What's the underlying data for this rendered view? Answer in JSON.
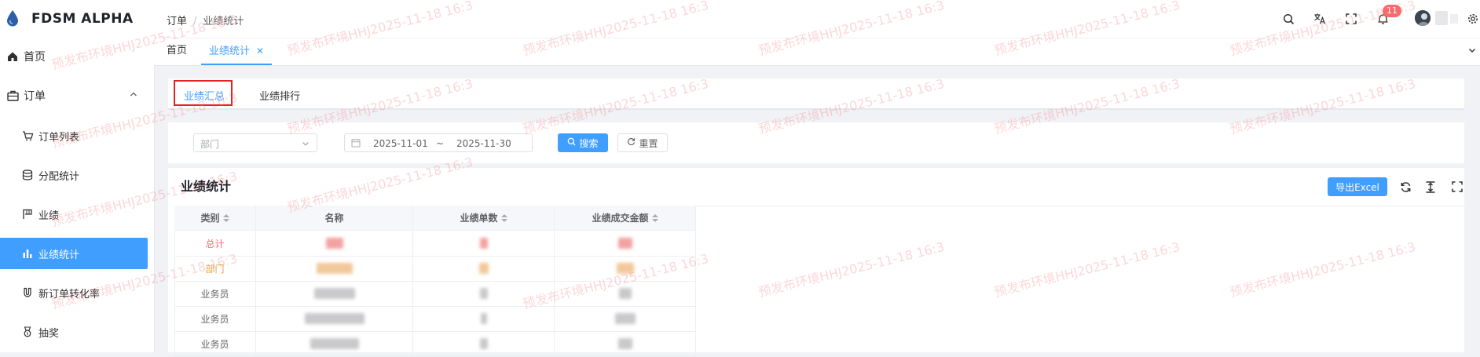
{
  "app": {
    "title": "FDSM ALPHA"
  },
  "sidebar": {
    "items": [
      {
        "label": "首页",
        "icon": "home-icon"
      },
      {
        "label": "订单",
        "icon": "briefcase-icon"
      },
      {
        "label": "订单列表",
        "icon": "cart-icon"
      },
      {
        "label": "分配统计",
        "icon": "database-icon"
      },
      {
        "label": "业绩",
        "icon": "flag-icon"
      },
      {
        "label": "业绩统计",
        "icon": "bar-chart-icon",
        "active": true
      },
      {
        "label": "新订单转化率",
        "icon": "magnet-icon"
      },
      {
        "label": "抽奖",
        "icon": "medal-icon"
      }
    ]
  },
  "header": {
    "breadcrumb": [
      "订单",
      "业绩统计"
    ],
    "notification_count": "11"
  },
  "tabs": [
    {
      "label": "首页"
    },
    {
      "label": "业绩统计",
      "active": true
    }
  ],
  "subtabs": [
    {
      "label": "业绩汇总",
      "active": true
    },
    {
      "label": "业绩排行"
    }
  ],
  "search": {
    "department_placeholder": "部门",
    "date_start": "2025-11-01",
    "date_separator": "~",
    "date_end": "2025-11-30",
    "search_label": "搜索",
    "reset_label": "重置"
  },
  "table": {
    "title": "业绩统计",
    "export_label": "导出Excel",
    "columns": [
      "类别",
      "名称",
      "业绩单数",
      "业绩成交金额"
    ],
    "rows": [
      {
        "category": "总计"
      },
      {
        "category": "部门"
      },
      {
        "category": "业务员"
      },
      {
        "category": "业务员"
      },
      {
        "category": "业务员"
      }
    ]
  },
  "watermark": "预发布环境HHJ2025-11-18 16:3",
  "colors": {
    "primary": "#409eff",
    "danger": "#f56c6c",
    "total": "#f56c6c",
    "dept": "#e6a23c"
  }
}
